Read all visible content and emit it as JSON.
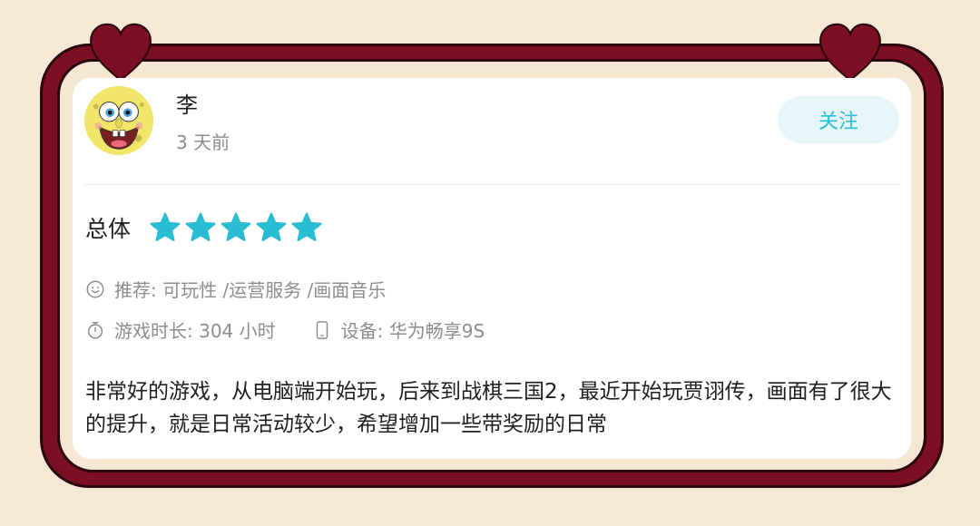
{
  "colors": {
    "background": "#f5e8d5",
    "frame": "#7d0f22",
    "heart": "#7d0f22",
    "accent": "#28bdd2",
    "star": "#28bdd2"
  },
  "review": {
    "user": {
      "name": "李",
      "time_ago": "3 天前",
      "avatar_icon": "spongebob-avatar"
    },
    "follow_label": "关注",
    "overall_label": "总体",
    "rating": {
      "value": 5,
      "max": 5
    },
    "recommend_text": "推荐: 可玩性 /运营服务 /画面音乐",
    "playtime_text": "游戏时长: 304 小时",
    "device_text": "设备: 华为畅享9S",
    "body": "非常好的游戏，从电脑端开始玩，后来到战棋三国2，最近开始玩贾诩传，画面有了很大的提升，就是日常活动较少，希望增加一些带奖励的日常"
  }
}
